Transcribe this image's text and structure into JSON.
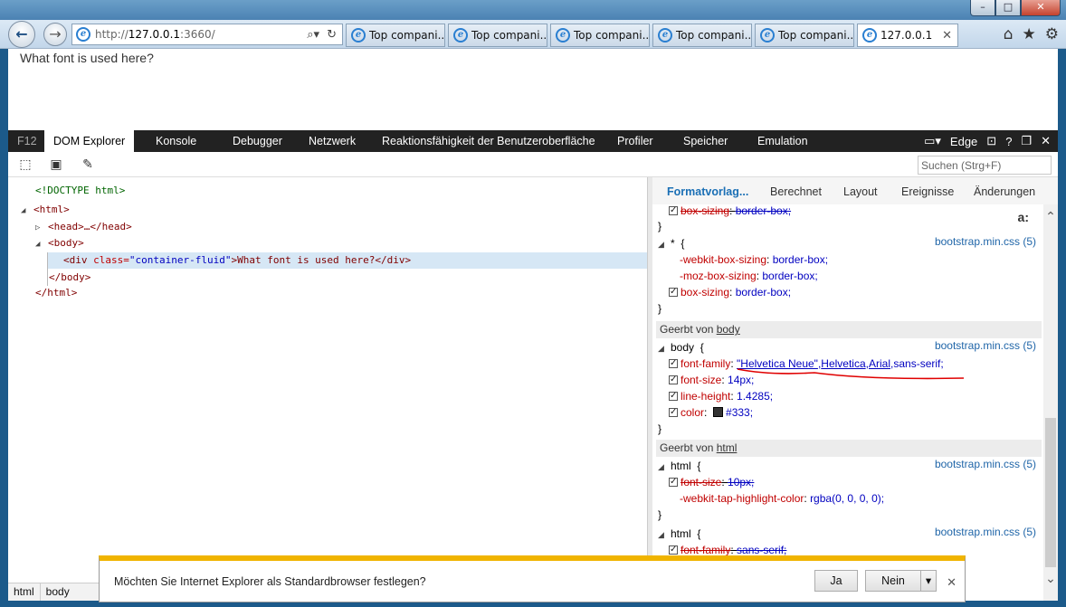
{
  "browser": {
    "address": {
      "protocol": "http://",
      "host": "127.0.0.1",
      "port": ":3660/"
    },
    "tabs": [
      {
        "label": "Top compani..."
      },
      {
        "label": "Top compani..."
      },
      {
        "label": "Top compani..."
      },
      {
        "label": "Top compani..."
      },
      {
        "label": "Top compani..."
      },
      {
        "label": "127.0.0.1"
      }
    ],
    "page_text": "What font is used here?"
  },
  "devtools": {
    "tabs": {
      "f12": "F12",
      "dom": "DOM Explorer",
      "console": "Konsole",
      "debugger": "Debugger",
      "network": "Netzwerk",
      "ui": "Reaktionsfähigkeit der Benutzeroberfläche",
      "profiler": "Profiler",
      "memory": "Speicher",
      "emulation": "Emulation"
    },
    "mode": "Edge",
    "search_placeholder": "Suchen (Strg+F)",
    "dom": {
      "doctype": "<!DOCTYPE html>",
      "html_open": "<html>",
      "head": "<head>…</head>",
      "body_open": "<body>",
      "div_open": "<div ",
      "div_attr": "class=",
      "div_val": "\"container-fluid\"",
      "div_rest": ">What font is used here?</div>",
      "body_close": "</body>",
      "html_close": "</html>"
    },
    "style_tabs": {
      "styles": "Formatvorlag...",
      "computed": "Berechnet",
      "layout": "Layout",
      "events": "Ereignisse",
      "changes": "Änderungen"
    },
    "rules": {
      "r0_prop": "box-sizing",
      "r0_val": "border-box;",
      "star_selector": "*",
      "star_source": "bootstrap.min.css (5)",
      "star_p1": "-webkit-box-sizing",
      "star_v1": "border-box;",
      "star_p2": "-moz-box-sizing",
      "star_v2": "border-box;",
      "star_p3": "box-sizing",
      "star_v3": "border-box;",
      "inherited_body_prefix": "Geerbt von ",
      "inherited_body": "body",
      "body_selector": "body",
      "body_source": "bootstrap.min.css (5)",
      "ff_prop": "font-family",
      "ff_val1": "\"Helvetica Neue\"",
      "ff_val2": "Helvetica",
      "ff_val3": "Arial",
      "ff_val4": "sans-serif",
      "fs_prop": "font-size",
      "fs_val": "14px;",
      "lh_prop": "line-height",
      "lh_val": "1.4285;",
      "color_prop": "color",
      "color_val": "#333;",
      "inherited_html_prefix": "Geerbt von ",
      "inherited_html": "html",
      "html_selector": "html",
      "html_source": "bootstrap.min.css (5)",
      "h_fs_prop": "font-size",
      "h_fs_val": "10px;",
      "tap_prop": "-webkit-tap-highlight-color",
      "tap_val": "rgba(0, 0, 0, 0);",
      "html2_selector": "html",
      "html2_source": "bootstrap.min.css (5)",
      "h2_ff_prop": "font-family",
      "h2_ff_val": "sans-serif;"
    },
    "breadcrumb": [
      "html",
      "body"
    ]
  },
  "notification": {
    "text": "Möchten Sie Internet Explorer als Standardbrowser festlegen?",
    "yes": "Ja",
    "no": "Nein"
  },
  "colors": {
    "annotation": "#e00000",
    "swatch": "#333333",
    "notify_accent": "#f0b400"
  }
}
